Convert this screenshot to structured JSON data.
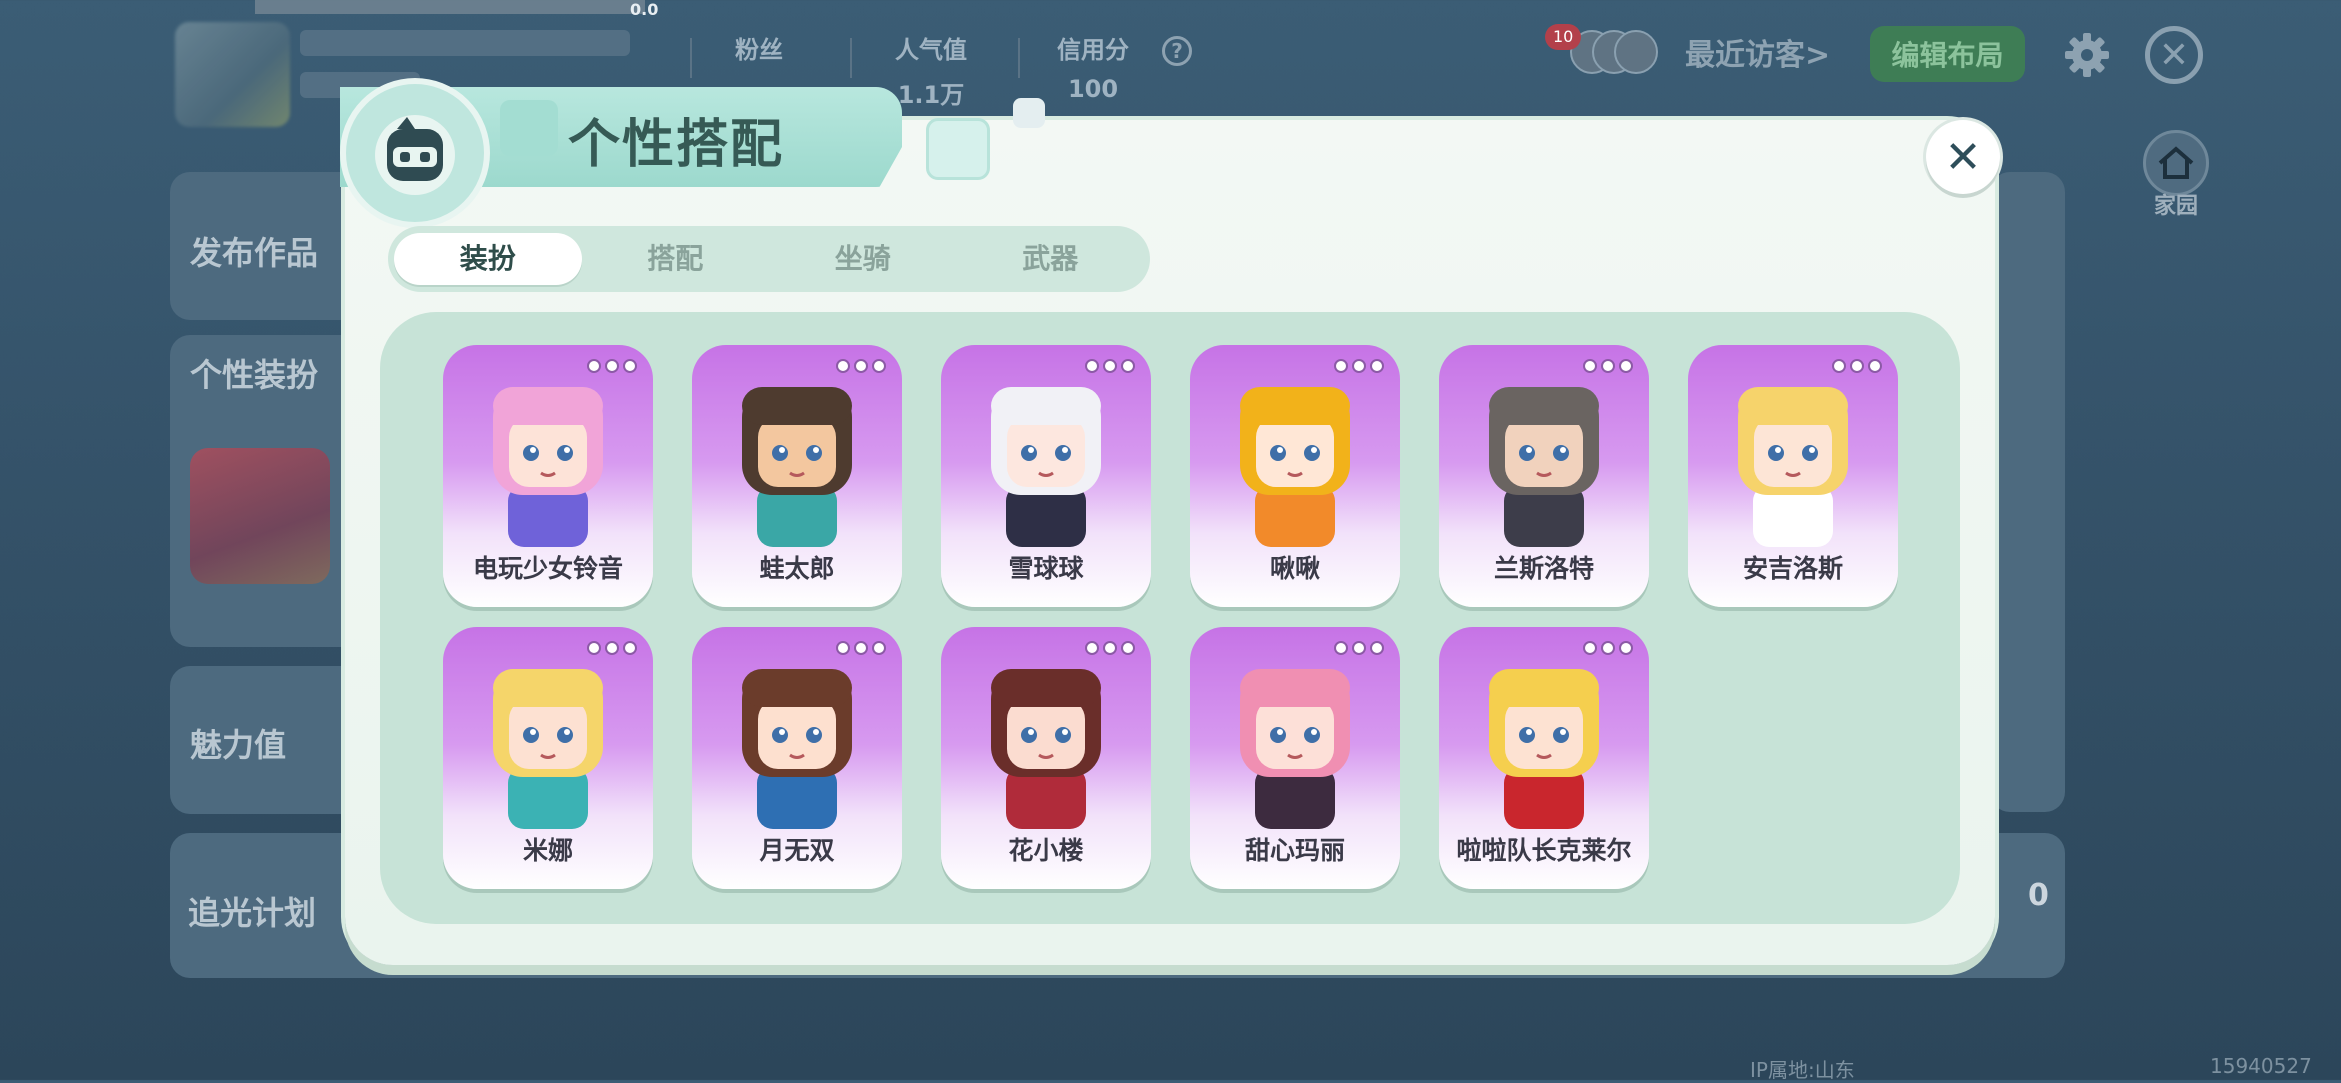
{
  "top_bar": {
    "version": "0.0",
    "stats": [
      {
        "label": "粉丝",
        "value": ""
      },
      {
        "label": "人气值",
        "value": "1.1万"
      },
      {
        "label": "信用分",
        "value": "100"
      }
    ],
    "visitor_count": "10",
    "recent_visitors": "最近访客>",
    "edit_layout": "编辑布局",
    "home": "家园"
  },
  "background": {
    "cards": [
      "发布作品",
      "个性装扮",
      "魅力值",
      "追光计划"
    ],
    "zero_value": "0",
    "footer_left": "IP属地:山东",
    "footer_right": "15940527"
  },
  "modal": {
    "title": "个性搭配",
    "close": "✕",
    "tabs": [
      {
        "label": "装扮",
        "active": true
      },
      {
        "label": "搭配",
        "active": false
      },
      {
        "label": "坐骑",
        "active": false
      },
      {
        "label": "武器",
        "active": false
      }
    ],
    "skins": [
      {
        "name": "电玩少女铃音",
        "hair": "#f1a4d8",
        "accent": "#6f62d9",
        "skin": "#fde3d8"
      },
      {
        "name": "蛙太郎",
        "hair": "#4e3b2f",
        "accent": "#3aa7a6",
        "skin": "#f3c79f"
      },
      {
        "name": "雪球球",
        "hair": "#f1f1f6",
        "accent": "#2e2f46",
        "skin": "#fde7df"
      },
      {
        "name": "啾啾",
        "hair": "#f2b21a",
        "accent": "#f28a2a",
        "skin": "#ffe7d6"
      },
      {
        "name": "兰斯洛特",
        "hair": "#6a6461",
        "accent": "#3d3d4a",
        "skin": "#f1d2bd"
      },
      {
        "name": "安吉洛斯",
        "hair": "#f6d36b",
        "accent": "#ffffff",
        "skin": "#fde5d6"
      },
      {
        "name": "米娜",
        "hair": "#f5d56a",
        "accent": "#3bb2b4",
        "skin": "#fde1d2"
      },
      {
        "name": "月无双",
        "hair": "#6b3c2b",
        "accent": "#2e6fb3",
        "skin": "#fde0cf"
      },
      {
        "name": "花小楼",
        "hair": "#6a2e2a",
        "accent": "#b02b3a",
        "skin": "#fbdcd0"
      },
      {
        "name": "甜心玛丽",
        "hair": "#f08fb2",
        "accent": "#3d2b3f",
        "skin": "#fde0d8"
      },
      {
        "name": "啦啦队长克莱尔",
        "hair": "#f5cf4e",
        "accent": "#c9262d",
        "skin": "#fde2d2"
      }
    ]
  }
}
